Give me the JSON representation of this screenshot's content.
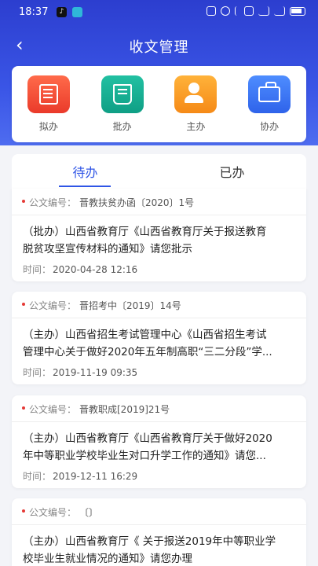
{
  "status_bar": {
    "time": "18:37",
    "app1": "♪"
  },
  "header": {
    "title": "收文管理",
    "back": "‹"
  },
  "shortcuts": [
    {
      "label": "拟办",
      "icon": "draft-doc-icon",
      "color": "#ea3a2a"
    },
    {
      "label": "批办",
      "icon": "approve-book-icon",
      "color": "#0f9f85"
    },
    {
      "label": "主办",
      "icon": "host-person-icon",
      "color": "#f58a17"
    },
    {
      "label": "协办",
      "icon": "assist-bag-icon",
      "color": "#2f63ea"
    }
  ],
  "tabs": [
    {
      "label": "待办",
      "active": true
    },
    {
      "label": "已办",
      "active": false
    }
  ],
  "list": {
    "code_label": "公文编号：",
    "time_label": "时间：",
    "items": [
      {
        "code": "晋教扶贫办函〔2020〕1号",
        "title_line1": "（批办）山西省教育厅《山西省教育厅关于报送教育",
        "title_line2": "脱贫攻坚宣传材料的通知》请您批示",
        "time": "2020-04-28 12:16"
      },
      {
        "code": "晋招考中〔2019〕14号",
        "title_line1": "（主办）山西省招生考试管理中心《山西省招生考试",
        "title_line2": "管理中心关于做好2020年五年制高职“三二分段”学...",
        "time": "2019-11-19 09:35"
      },
      {
        "code": "晋教职成[2019]21号",
        "title_line1": "（主办）山西省教育厅《山西省教育厅关于做好2020",
        "title_line2": "年中等职业学校毕业生对口升学工作的通知》请您...",
        "time": "2019-12-11 16:29"
      },
      {
        "code": "〔〕",
        "title_line1": "（主办）山西省教育厅《 关于报送2019年中等职业学",
        "title_line2": "校毕业生就业情况的通知》请您办理",
        "time": ""
      }
    ]
  }
}
